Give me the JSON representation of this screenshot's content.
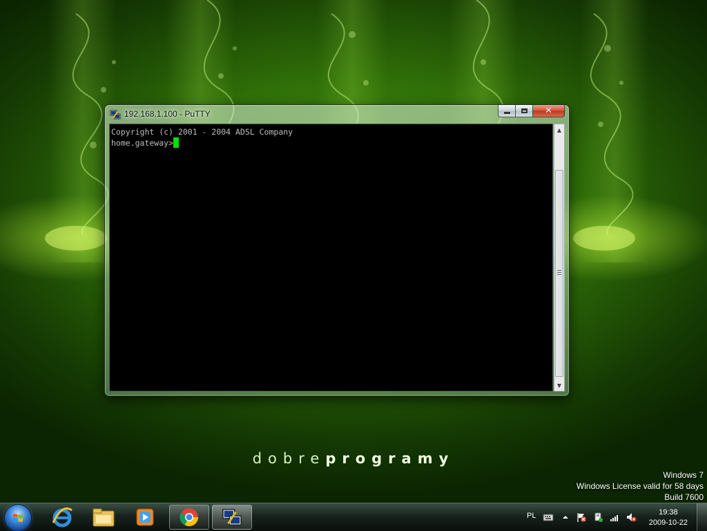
{
  "desktop": {
    "brand_light": "dobre",
    "brand_bold": "programy",
    "watermark": {
      "line1": "Windows 7",
      "line2": "Windows License valid for 58 days",
      "line3": "Build 7600"
    }
  },
  "window": {
    "title": "192.168.1.100 - PuTTY",
    "icon": "putty-icon",
    "terminal": {
      "line1": "Copyright (c) 2001 - 2004 ADSL Company",
      "prompt": "home.gateway>"
    }
  },
  "taskbar": {
    "start_icon": "windows-start-icon",
    "pinned": [
      {
        "name": "internet-explorer-icon"
      },
      {
        "name": "windows-explorer-icon"
      },
      {
        "name": "media-player-icon"
      },
      {
        "name": "chrome-icon"
      },
      {
        "name": "putty-icon"
      }
    ],
    "tray": {
      "language": "PL",
      "time": "19:38",
      "date": "2009-10-22"
    }
  },
  "colors": {
    "cursor": "#00e000",
    "terminal_bg": "#000000",
    "terminal_fg": "#bdbdbd"
  }
}
